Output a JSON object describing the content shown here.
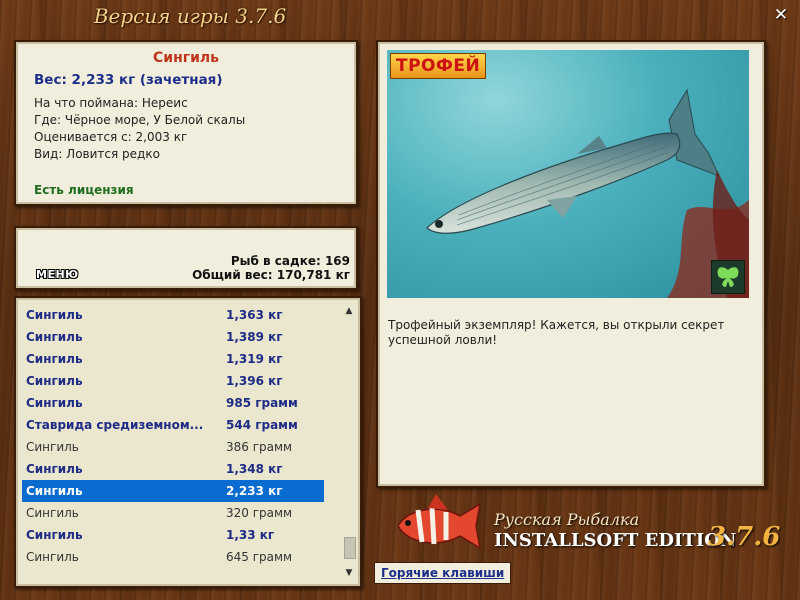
{
  "app": {
    "title": "Версия игры 3.7.6",
    "close_label": "✕"
  },
  "fish_info": {
    "name": "Сингиль",
    "weight": "Вес: 2,233 кг (зачетная)",
    "lines": [
      "На что поймана: Нереис",
      "Где: Чёрное море, У Белой скалы",
      "Оценивается с: 2,003 кг",
      "Вид: Ловится редко"
    ],
    "license": "Есть лицензия"
  },
  "stats": {
    "menu_label": "МЕНЮ",
    "count": "Рыб в садке: 169",
    "total": "Общий вес: 170,781 кг"
  },
  "catch_list": [
    {
      "name": "Сингиль",
      "weight": "1,363 кг",
      "style": "bold"
    },
    {
      "name": "Сингиль",
      "weight": "1,389 кг",
      "style": "bold"
    },
    {
      "name": "Сингиль",
      "weight": "1,319 кг",
      "style": "bold"
    },
    {
      "name": "Сингиль",
      "weight": "1,396 кг",
      "style": "bold"
    },
    {
      "name": "Сингиль",
      "weight": "985 грамм",
      "style": "bold"
    },
    {
      "name": "Ставрида средиземном...",
      "weight": "544 грамм",
      "style": "bold"
    },
    {
      "name": "Сингиль",
      "weight": "386 грамм",
      "style": "plain"
    },
    {
      "name": "Сингиль",
      "weight": "1,348 кг",
      "style": "bold"
    },
    {
      "name": "Сингиль",
      "weight": "2,233 кг",
      "style": "sel"
    },
    {
      "name": "Сингиль",
      "weight": "320 грамм",
      "style": "plain"
    },
    {
      "name": "Сингиль",
      "weight": "1,33 кг",
      "style": "bold"
    },
    {
      "name": "Сингиль",
      "weight": "645 грамм",
      "style": "plain"
    }
  ],
  "scrollbar": {
    "up_icon": "▲",
    "down_icon": "▼",
    "position": 0.97
  },
  "picture": {
    "badge": "ТРОФЕЙ",
    "description": "Трофейный экземпляр! Кажется, вы открыли секрет успешной ловли!"
  },
  "branding": {
    "line1": "Русская Рыбалка",
    "line2": "INSTALLSOFT EDITION",
    "version": "3.7.6"
  },
  "hotkeys_label": "Горячие клавиши"
}
